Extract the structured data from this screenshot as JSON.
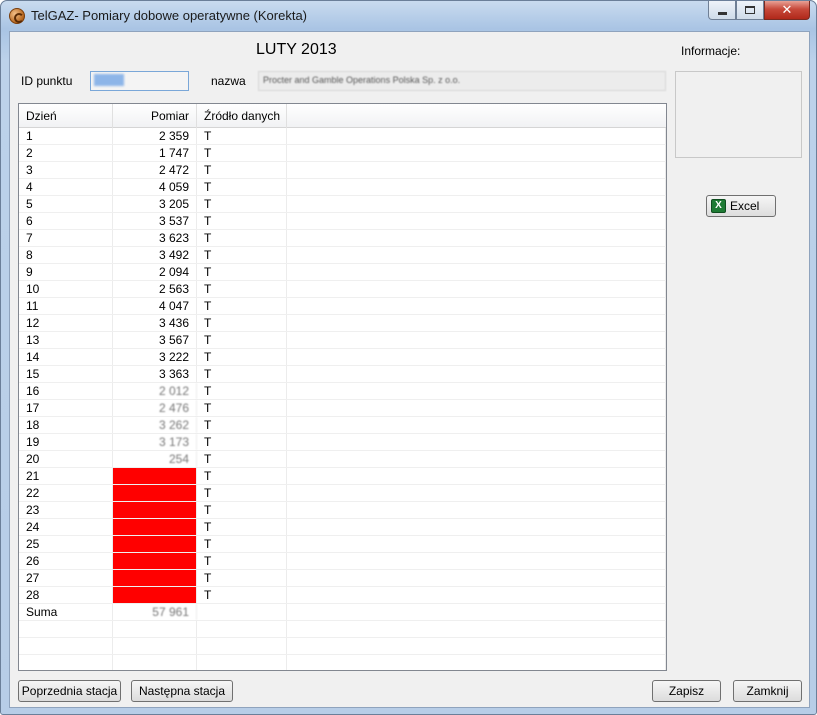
{
  "window": {
    "title": "TelGAZ- Pomiary dobowe operatywne (Korekta)"
  },
  "heading": "LUTY 2013",
  "info": {
    "label": "Informacje:"
  },
  "form": {
    "id_label": "ID punktu",
    "name_label": "nazwa",
    "name_value": "Procter and Gamble Operations Polska Sp. z o.o."
  },
  "excel_label": "Excel",
  "table": {
    "columns": [
      "Dzień",
      "Pomiar",
      "Źródło danych"
    ],
    "rows": [
      {
        "day": "1",
        "value": "2 359",
        "source": "T"
      },
      {
        "day": "2",
        "value": "1 747",
        "source": "T"
      },
      {
        "day": "3",
        "value": "2 472",
        "source": "T"
      },
      {
        "day": "4",
        "value": "4 059",
        "source": "T"
      },
      {
        "day": "5",
        "value": "3 205",
        "source": "T"
      },
      {
        "day": "6",
        "value": "3 537",
        "source": "T"
      },
      {
        "day": "7",
        "value": "3 623",
        "source": "T"
      },
      {
        "day": "8",
        "value": "3 492",
        "source": "T"
      },
      {
        "day": "9",
        "value": "2 094",
        "source": "T"
      },
      {
        "day": "10",
        "value": "2 563",
        "source": "T"
      },
      {
        "day": "11",
        "value": "4 047",
        "source": "T"
      },
      {
        "day": "12",
        "value": "3 436",
        "source": "T"
      },
      {
        "day": "13",
        "value": "3 567",
        "source": "T"
      },
      {
        "day": "14",
        "value": "3 222",
        "source": "T"
      },
      {
        "day": "15",
        "value": "3 363",
        "source": "T"
      },
      {
        "day": "16",
        "value": "2 012",
        "source": "T",
        "blurred": true
      },
      {
        "day": "17",
        "value": "2 476",
        "source": "T",
        "blurred": true
      },
      {
        "day": "18",
        "value": "3 262",
        "source": "T",
        "blurred": true
      },
      {
        "day": "19",
        "value": "3 173",
        "source": "T",
        "blurred": true
      },
      {
        "day": "20",
        "value": "254",
        "source": "T",
        "blurred": true
      },
      {
        "day": "21",
        "value": "",
        "source": "T",
        "missing": true
      },
      {
        "day": "22",
        "value": "",
        "source": "T",
        "missing": true
      },
      {
        "day": "23",
        "value": "",
        "source": "T",
        "missing": true
      },
      {
        "day": "24",
        "value": "",
        "source": "T",
        "missing": true
      },
      {
        "day": "25",
        "value": "",
        "source": "T",
        "missing": true
      },
      {
        "day": "26",
        "value": "",
        "source": "T",
        "missing": true
      },
      {
        "day": "27",
        "value": "",
        "source": "T",
        "missing": true
      },
      {
        "day": "28",
        "value": "",
        "source": "T",
        "missing": true
      },
      {
        "day": "Suma",
        "value": "57 961",
        "source": "",
        "blurred": true
      },
      {
        "day": "",
        "value": "",
        "source": ""
      },
      {
        "day": "",
        "value": "",
        "source": ""
      },
      {
        "day": "",
        "value": "",
        "source": ""
      }
    ]
  },
  "buttons": {
    "prev": "Poprzednia stacja",
    "next": "Następna stacja",
    "save": "Zapisz",
    "close": "Zamknij"
  },
  "colors": {
    "missing": "#ff0000",
    "selection": "#8db5e8"
  }
}
